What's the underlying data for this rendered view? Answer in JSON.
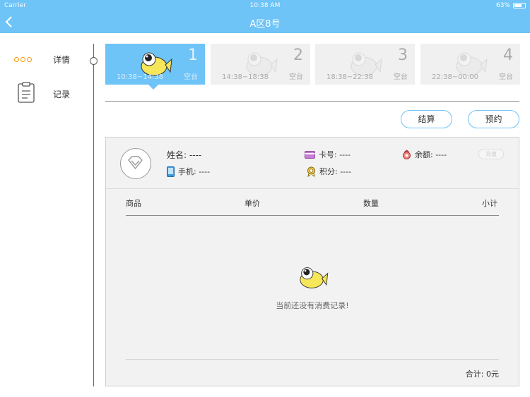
{
  "status_bar": {
    "carrier": "Carrier",
    "time": "10:38 AM",
    "battery": "63%"
  },
  "nav": {
    "title": "A区8号"
  },
  "sidebar": {
    "items": [
      {
        "label": "详情",
        "icon": "more-dots-icon"
      },
      {
        "label": "记录",
        "icon": "clipboard-icon"
      }
    ]
  },
  "slots": [
    {
      "number": "1",
      "time": "10:38~14:38",
      "status": "空台",
      "active": true
    },
    {
      "number": "2",
      "time": "14:38~18:38",
      "status": "空台",
      "active": false
    },
    {
      "number": "3",
      "time": "18:38~22:38",
      "status": "空台",
      "active": false
    },
    {
      "number": "4",
      "time": "22:38~00:00",
      "status": "空台",
      "active": false
    }
  ],
  "actions": {
    "settle": "结算",
    "reserve": "预约"
  },
  "member": {
    "name": "姓名: ----",
    "phone": "手机: ----",
    "card": "卡号: ----",
    "points": "积分: ----",
    "balance": "余额: ----",
    "recharge": "充值"
  },
  "table": {
    "headers": [
      "商品",
      "单价",
      "数量",
      "小计"
    ],
    "empty_message": "当前还没有消费记录!"
  },
  "total": "合计: 0元",
  "colors": {
    "accent": "#6ec3f7",
    "dots": "#f39800",
    "fish": "#f5e65a"
  }
}
